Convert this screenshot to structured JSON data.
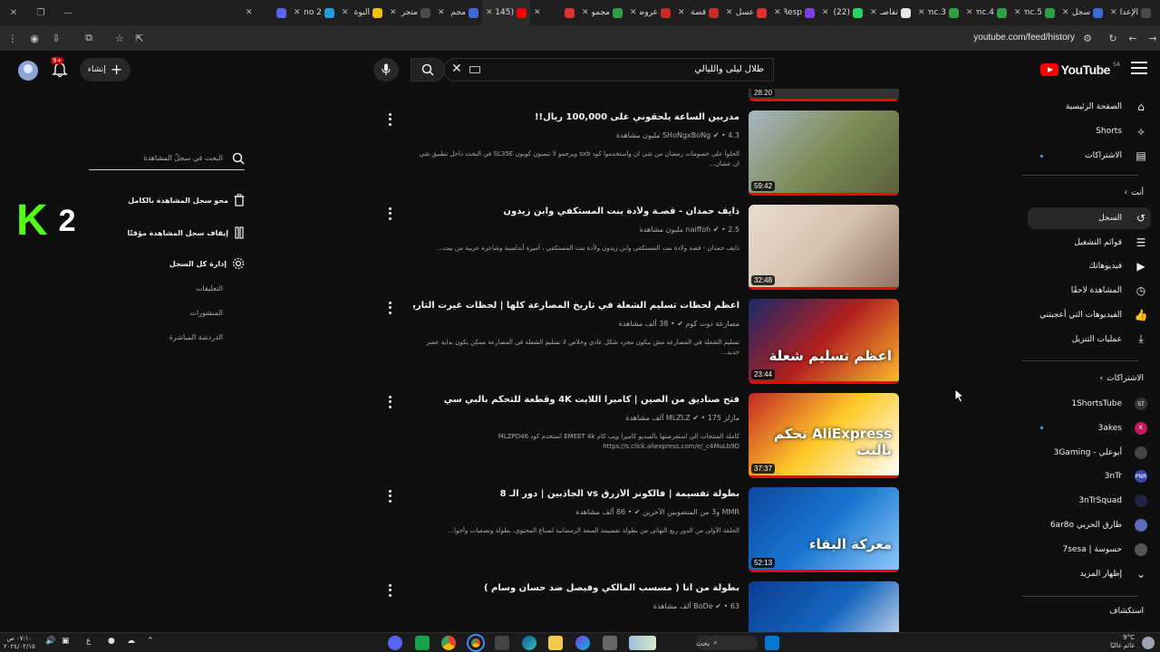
{
  "browser": {
    "tabs": [
      {
        "title": "الإعدا",
        "color": "#4a4a4a"
      },
      {
        "title": "سجل",
        "color": "#3a6ad8"
      },
      {
        "title": "5.mc",
        "color": "#2f9e44"
      },
      {
        "title": "4.mc",
        "color": "#2f9e44"
      },
      {
        "title": "3.mc",
        "color": "#2f9e44"
      },
      {
        "title": "تفاصـ",
        "color": "#e6e6e6"
      },
      {
        "title": "(22)",
        "color": "#25d366"
      },
      {
        "title": "Resp",
        "color": "#7b3fe4"
      },
      {
        "title": "عسل",
        "color": "#e03131"
      },
      {
        "title": "قصة",
        "color": "#c92a2a"
      },
      {
        "title": "عروض",
        "color": "#c92a2a"
      },
      {
        "title": "مجمو",
        "color": "#2f9e44"
      },
      {
        "title": "",
        "color": "#e03131"
      },
      {
        "title": "(145)",
        "color": "#ff0000"
      },
      {
        "title": "مجم",
        "color": "#3a6ad8"
      },
      {
        "title": "متجر",
        "color": "#4a4a4a"
      },
      {
        "title": "البوة",
        "color": "#f2c200"
      },
      {
        "title": "2 no",
        "color": "#229ed9"
      },
      {
        "title": "",
        "color": "#5865f2"
      }
    ],
    "url": "youtube.com/feed/history"
  },
  "masthead": {
    "logo_text": "YouTube",
    "logo_region": "SA",
    "search_query": "طلال ليلى والليالي",
    "create_label": "إنشاء",
    "notification_count": "9+"
  },
  "guide": {
    "main": [
      {
        "label": "الصفحة الرئيسية",
        "icon": "home-icon"
      },
      {
        "label": "Shorts",
        "icon": "shorts-icon"
      },
      {
        "label": "الاشتراكات",
        "icon": "subscriptions-icon"
      }
    ],
    "you_header": "أنت",
    "you": [
      {
        "label": "السجل",
        "icon": "history-icon",
        "active": true
      },
      {
        "label": "قوائم التشغيل",
        "icon": "playlists-icon"
      },
      {
        "label": "فيديوهاتك",
        "icon": "your-videos-icon"
      },
      {
        "label": "المشاهدة لاحقًا",
        "icon": "watch-later-icon"
      },
      {
        "label": "الفيديوهات التي أعجبتني",
        "icon": "like-icon"
      },
      {
        "label": "عمليات التنزيل",
        "icon": "download-icon"
      }
    ],
    "subs_header": "الاشتراكات",
    "subscriptions": [
      {
        "label": "1ShortsTube",
        "color": "#333333",
        "avatar": "ST"
      },
      {
        "label": "3akes",
        "color": "#c2185b",
        "avatar": "K",
        "dot": true
      },
      {
        "label": "أبوعلي - 3Gaming",
        "color": "#444444",
        "avatar": ""
      },
      {
        "label": "3nTr",
        "color": "#3949ab",
        "avatar": "PNR"
      },
      {
        "label": "3nTrSquad",
        "color": "#222244",
        "avatar": ""
      },
      {
        "label": "طارق الحربي 6ar8o",
        "color": "#5c6bc0",
        "avatar": ""
      },
      {
        "label": "حسوسة | 7sesa",
        "color": "#555555",
        "avatar": ""
      }
    ],
    "show_more": "إظهار المزيد",
    "explore": "استكشاف"
  },
  "history_panel": {
    "search_placeholder": "البحث في سجلّ المشاهدة",
    "clear_all": "محو سجل المشاهدة بالكامل",
    "pause": "إيقاف سجل المشاهدة مؤقتًا",
    "manage": "إدارة كل السجل",
    "links": [
      "التعليقات",
      "المنشورات",
      "الدردشة المباشرة"
    ]
  },
  "overlay_logo": {
    "k": "K",
    "num": "2"
  },
  "top_partial_duration": "28:20",
  "videos": [
    {
      "title": "مدربين الساعة يلحقوني على 100,000 ريال!!",
      "channel": "SHoNgxBoNg",
      "views": "4.3 مليون مشاهدة",
      "desc": "الحلوا على خصومات رمضان من شي ان واستخدموا كود sxb ويرحمو لا تنسون كوبون SL35E في البحث داخل تطبيق شي ان عشان...",
      "duration": "59:42",
      "colors": [
        "#a8b7c4",
        "#7e8d5a",
        "#5a5f3a"
      ]
    },
    {
      "title": "ذايف حمدان - قصـة ولأدة بنت المستكفي وابن زيدون",
      "channel": "naiffoh",
      "views": "2.5 مليون مشاهدة",
      "desc": "ذايف حمدان - قصة ولادة بنت المستكفي وابن زيدون ولأدة بنت المستكفي ، أميرة أندلسية وشاعرة عربية من بيت...",
      "duration": "32:48",
      "colors": [
        "#e8dcd0",
        "#d6c2ad",
        "#8e7260"
      ]
    },
    {
      "title": "اعظم لحظات تسليم الشعلة في تاريخ المصارعة كلها | لحظات غيرت التاريخ للأبد",
      "channel": "مصارعة دوت كوم",
      "views": "38 ألف مشاهدة",
      "desc": "تسليم الشعلة في المصارعة مش بيكون مجرد شكل عادي وخلاص لا تسليم الشعلة في المصارعة ممكن يكون بداية عصر جديد...",
      "duration": "23:44",
      "colors": [
        "#1a2a6c",
        "#b21f1f",
        "#fdbb2d"
      ],
      "overlay": "اعظم تسليم شعلة"
    },
    {
      "title": "فتح صناديق من الصين | كاميرا اللايت 4K وقطعة للتحكم بالبي سي",
      "channel": "مازلز MLZLZ",
      "views": "175 ألف مشاهدة",
      "desc": "كاملة المنتجات الي استعرضتها بالفيديو كاميرا ويب كام EMEET 4k استخدم كود MLZPD46 https://s.click.aliexpress.com/e/_c4MuLb9D",
      "duration": "37:37",
      "colors": [
        "#c62828",
        "#ffca28",
        "#ffffff"
      ],
      "overlay": "AliExpress تحكم بالبث"
    },
    {
      "title": "بطولة تفسيمة | فالكونز الأزرق vs الجاذبين | دور الـ 8",
      "channel": "MMR و3 من المنصوبين الآخرين",
      "views": "86 ألف مشاهدة",
      "desc": "الحلقة الأولى من الدور ربع النهائي من بطولة تفسيمة السعة الرمضانية لصناع المحتوى، بطولة وتصفيات وأجوا...",
      "duration": "52:13",
      "colors": [
        "#0d47a1",
        "#1976d2",
        "#90caf9"
      ],
      "overlay": "معركة البقاء"
    },
    {
      "title": "بطولة من أنا ( مسسب المالكي وفيصل ضد حسان وسام )",
      "channel": "BoDe",
      "views": "63 ألف مشاهدة",
      "desc": "",
      "duration": "",
      "colors": [
        "#0b3d91",
        "#1565c0",
        "#f5f5f5"
      ]
    }
  ],
  "taskbar": {
    "search_label": "بحث",
    "weather_temp": "9°C",
    "weather_desc": "غائم غالبًا",
    "time": "٠٧:١٠ ص",
    "date": "٢٠٢٤/٠٢/١٥",
    "lang": "ع"
  }
}
